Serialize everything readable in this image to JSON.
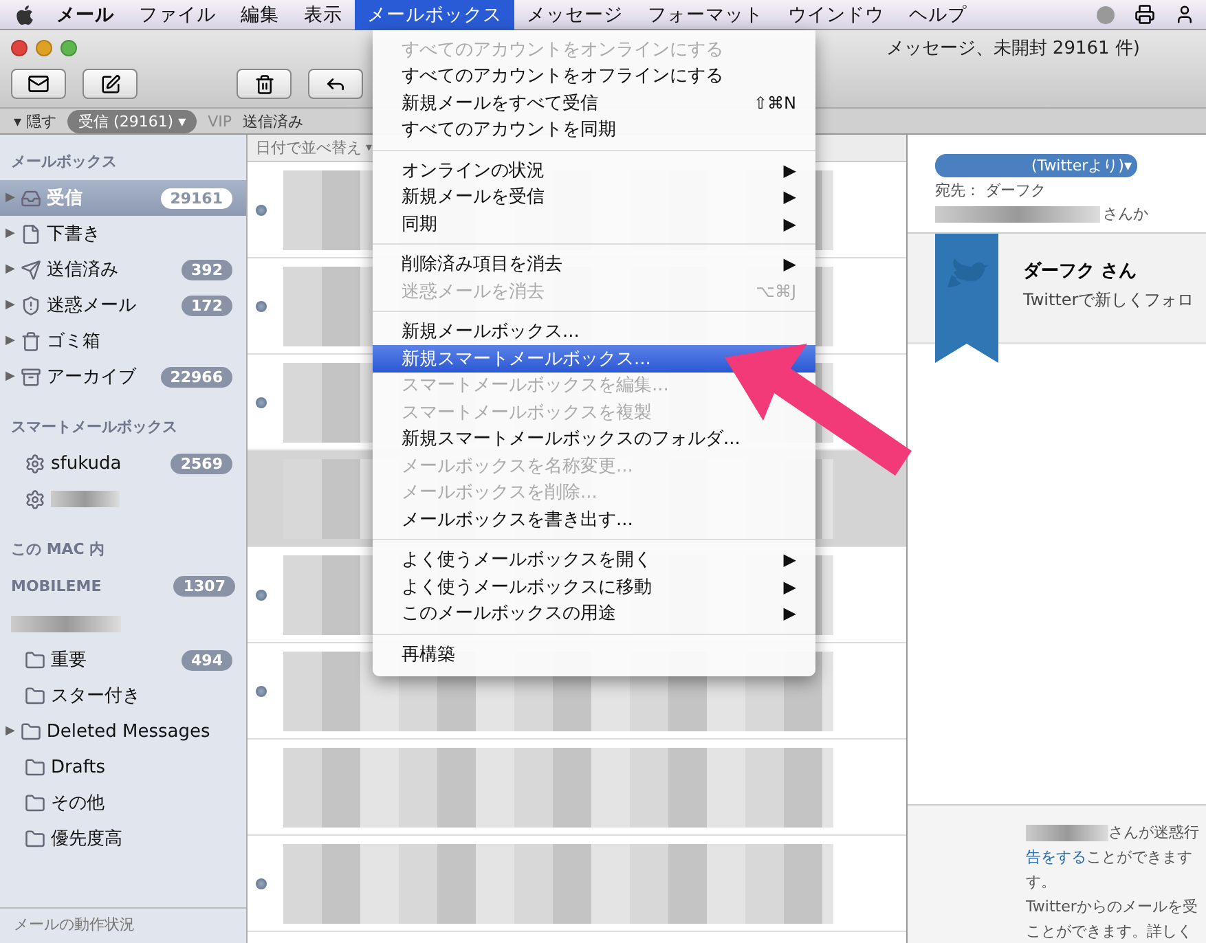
{
  "menubar": {
    "items": [
      {
        "label": "メール",
        "selected": false
      },
      {
        "label": "ファイル",
        "selected": false
      },
      {
        "label": "編集",
        "selected": false
      },
      {
        "label": "表示",
        "selected": false
      },
      {
        "label": "メールボックス",
        "selected": true
      },
      {
        "label": "メッセージ",
        "selected": false
      },
      {
        "label": "フォーマット",
        "selected": false
      },
      {
        "label": "ウインドウ",
        "selected": false
      },
      {
        "label": "ヘルプ",
        "selected": false
      }
    ]
  },
  "window": {
    "title": "メッセージ、未開封 29161 件)"
  },
  "favorites_bar": {
    "hide_arrow": "▾",
    "hide": "隠す",
    "inbox": "受信 (29161)",
    "inbox_arrow": "▾",
    "vip": "VIP",
    "sent": "送信済み"
  },
  "sidebar": {
    "sections": [
      {
        "heading": "メールボックス",
        "items": [
          {
            "kind": "mailbox",
            "disclosure": "▶",
            "label": "受信",
            "count": "29161",
            "selected": true
          },
          {
            "kind": "mailbox",
            "disclosure": "▶",
            "label": "下書き",
            "selected": false
          },
          {
            "kind": "mailbox",
            "disclosure": "▶",
            "label": "送信済み",
            "count": "392",
            "selected": false
          },
          {
            "kind": "mailbox",
            "disclosure": "▶",
            "label": "迷惑メール",
            "count": "172",
            "selected": false
          },
          {
            "kind": "mailbox",
            "disclosure": "▶",
            "label": "ゴミ箱",
            "selected": false
          },
          {
            "kind": "mailbox",
            "disclosure": "▶",
            "label": "アーカイブ",
            "count": "22966",
            "selected": false
          }
        ]
      },
      {
        "heading": "スマートメールボックス",
        "items": [
          {
            "kind": "smart",
            "label": "sfukuda",
            "count": "2569",
            "selected": false
          },
          {
            "kind": "smart",
            "selected": false
          }
        ]
      },
      {
        "heading": "この MAC 内"
      },
      {
        "heading": "MOBILEME",
        "count": "1307"
      },
      {
        "items": [
          {
            "kind": "folder",
            "label": "重要",
            "count": "494",
            "selected": false
          },
          {
            "kind": "folder",
            "label": "スター付き",
            "selected": false
          },
          {
            "kind": "folder",
            "disclosure": "▶",
            "label": "Deleted Messages",
            "selected": false
          },
          {
            "kind": "folder",
            "label": "Drafts",
            "selected": false
          },
          {
            "kind": "folder",
            "label": "その他",
            "selected": false
          },
          {
            "kind": "folder",
            "label": "優先度高",
            "selected": false
          }
        ]
      }
    ],
    "activity": "メールの動作状況"
  },
  "message_list": {
    "sort": "日付で並べ替え",
    "sort_arrow": "▾",
    "rows": [
      {
        "unread": true,
        "selected": false
      },
      {
        "unread": true,
        "selected": false
      },
      {
        "unread": true,
        "selected": false
      },
      {
        "unread": false,
        "selected": true
      },
      {
        "unread": true,
        "selected": false
      },
      {
        "unread": true,
        "selected": false
      },
      {
        "unread": false,
        "selected": false
      },
      {
        "unread": true,
        "selected": false
      }
    ]
  },
  "menu": {
    "items": [
      {
        "kind": "item",
        "label": "すべてのアカウントをオンラインにする",
        "disabled": true,
        "selected": false
      },
      {
        "kind": "item",
        "label": "すべてのアカウントをオフラインにする",
        "disabled": false,
        "selected": false
      },
      {
        "kind": "item",
        "label": "新規メールをすべて受信",
        "disabled": false,
        "selected": false,
        "shortcut": "⇧⌘N"
      },
      {
        "kind": "item",
        "label": "すべてのアカウントを同期",
        "disabled": false,
        "selected": false
      },
      {
        "kind": "separator"
      },
      {
        "kind": "item",
        "label": "オンラインの状況",
        "disabled": false,
        "selected": false,
        "arrow": "▶"
      },
      {
        "kind": "item",
        "label": "新規メールを受信",
        "disabled": false,
        "selected": false,
        "arrow": "▶"
      },
      {
        "kind": "item",
        "label": "同期",
        "disabled": false,
        "selected": false,
        "arrow": "▶"
      },
      {
        "kind": "separator"
      },
      {
        "kind": "item",
        "label": "削除済み項目を消去",
        "disabled": false,
        "selected": false,
        "arrow": "▶"
      },
      {
        "kind": "item",
        "label": "迷惑メールを消去",
        "disabled": true,
        "selected": false,
        "shortcut": "⌥⌘J"
      },
      {
        "kind": "separator"
      },
      {
        "kind": "item",
        "label": "新規メールボックス...",
        "disabled": false,
        "selected": false
      },
      {
        "kind": "item",
        "label": "新規スマートメールボックス...",
        "disabled": false,
        "selected": true
      },
      {
        "kind": "item",
        "label": "スマートメールボックスを編集...",
        "disabled": true,
        "selected": false
      },
      {
        "kind": "item",
        "label": "スマートメールボックスを複製",
        "disabled": true,
        "selected": false
      },
      {
        "kind": "item",
        "label": "新規スマートメールボックスのフォルダ...",
        "disabled": false,
        "selected": false
      },
      {
        "kind": "item",
        "label": "メールボックスを名称変更...",
        "disabled": true,
        "selected": false
      },
      {
        "kind": "item",
        "label": "メールボックスを削除...",
        "disabled": true,
        "selected": false
      },
      {
        "kind": "item",
        "label": "メールボックスを書き出す...",
        "disabled": false,
        "selected": false
      },
      {
        "kind": "separator"
      },
      {
        "kind": "item",
        "label": "よく使うメールボックスを開く",
        "disabled": false,
        "selected": false,
        "arrow": "▶"
      },
      {
        "kind": "item",
        "label": "よく使うメールボックスに移動",
        "disabled": false,
        "selected": false,
        "arrow": "▶"
      },
      {
        "kind": "item",
        "label": "このメールボックスの用途",
        "disabled": false,
        "selected": false,
        "arrow": "▶"
      },
      {
        "kind": "separator"
      },
      {
        "kind": "item",
        "label": "再構築",
        "disabled": false,
        "selected": false
      }
    ]
  },
  "reader": {
    "sender": "(Twitterより)▾",
    "to": "宛先： ダーフク",
    "summary": "さんか",
    "card_title": "ダーフク さん",
    "card_text": "Twitterで新しくフォロ",
    "footer_lines": [
      {
        "text": "さんが迷惑行",
        "redacted": true
      },
      {
        "link": "告をする",
        "text": "ことができます"
      },
      {
        "text": "す。"
      },
      {
        "text": "Twitterからのメールを受"
      },
      {
        "text": "ことができます。詳しく"
      }
    ]
  }
}
